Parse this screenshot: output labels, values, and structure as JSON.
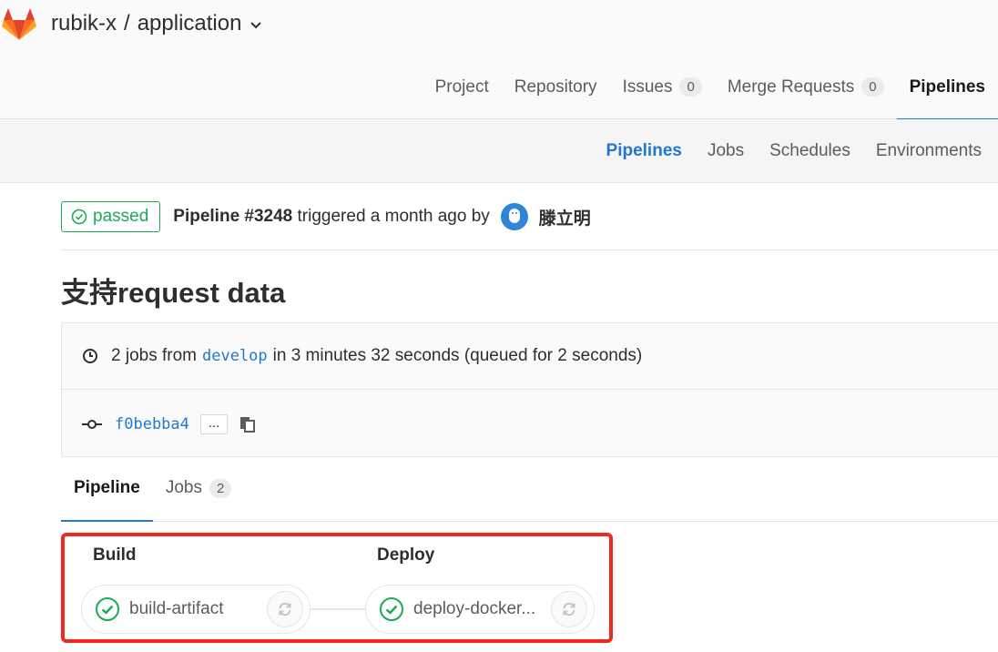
{
  "header": {
    "namespace": "rubik-x",
    "separator": "/",
    "project": "application"
  },
  "main_nav": {
    "items": [
      {
        "label": "Project"
      },
      {
        "label": "Repository"
      },
      {
        "label": "Issues",
        "count": "0"
      },
      {
        "label": "Merge Requests",
        "count": "0"
      },
      {
        "label": "Pipelines",
        "active": true
      }
    ]
  },
  "sub_nav": {
    "items": [
      {
        "label": "Pipelines",
        "active": true
      },
      {
        "label": "Jobs"
      },
      {
        "label": "Schedules"
      },
      {
        "label": "Environments"
      }
    ]
  },
  "pipeline": {
    "status": "passed",
    "title": "Pipeline #3248",
    "triggered_text": "triggered a month ago by",
    "author": "滕立明",
    "commit_title": "支持request data",
    "summary": {
      "prefix": "2 jobs from",
      "branch": "develop",
      "suffix": "in 3 minutes 32 seconds (queued for 2 seconds)"
    },
    "commit_sha": "f0bebba4",
    "ellipsis": "..."
  },
  "tabs": [
    {
      "label": "Pipeline",
      "active": true
    },
    {
      "label": "Jobs",
      "count": "2"
    }
  ],
  "stages": [
    {
      "name": "Build",
      "job": "build-artifact"
    },
    {
      "name": "Deploy",
      "job": "deploy-docker..."
    }
  ],
  "colors": {
    "success": "#1aaa55",
    "link": "#1f78d1",
    "highlight_frame": "#f0281e"
  }
}
